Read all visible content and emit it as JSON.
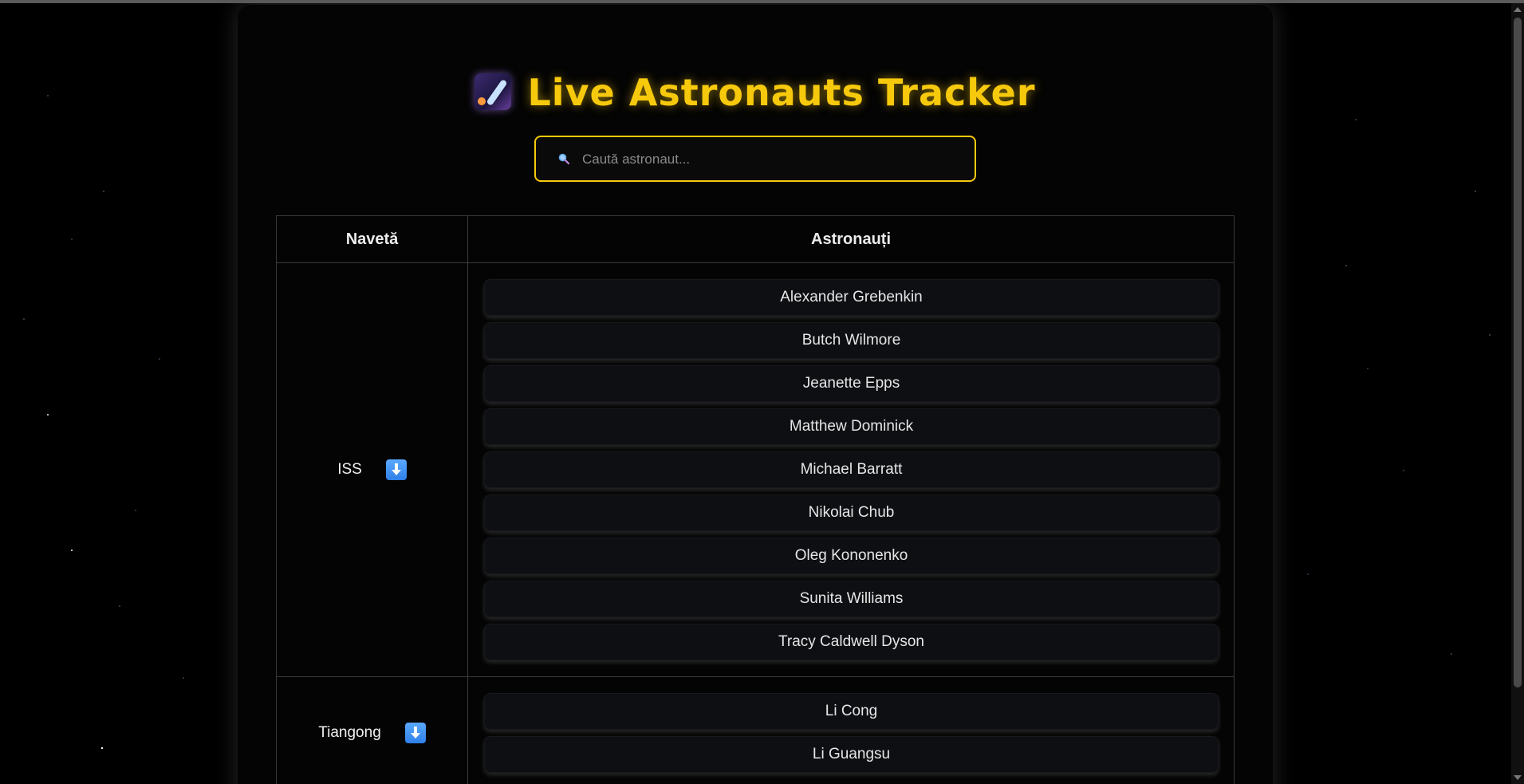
{
  "header": {
    "title": "Live Astronauts Tracker",
    "title_icon": "shooting-star-icon"
  },
  "search": {
    "placeholder": "Caută astronaut...",
    "value": "",
    "icon": "search-icon"
  },
  "table": {
    "columns": [
      "Navetă",
      "Astronauți"
    ],
    "craft": [
      {
        "name": "ISS",
        "toggle_icon": "down-arrow-icon",
        "astronauts": [
          "Alexander Grebenkin",
          "Butch Wilmore",
          "Jeanette Epps",
          "Matthew Dominick",
          "Michael Barratt",
          "Nikolai Chub",
          "Oleg Kononenko",
          "Sunita Williams",
          "Tracy Caldwell Dyson"
        ]
      },
      {
        "name": "Tiangong",
        "toggle_icon": "down-arrow-icon",
        "astronauts": [
          "Li Cong",
          "Li Guangsu"
        ]
      }
    ]
  },
  "colors": {
    "accent": "#f7c90d",
    "background": "#000000",
    "panel": "#040404",
    "button": "#2f80e8"
  }
}
